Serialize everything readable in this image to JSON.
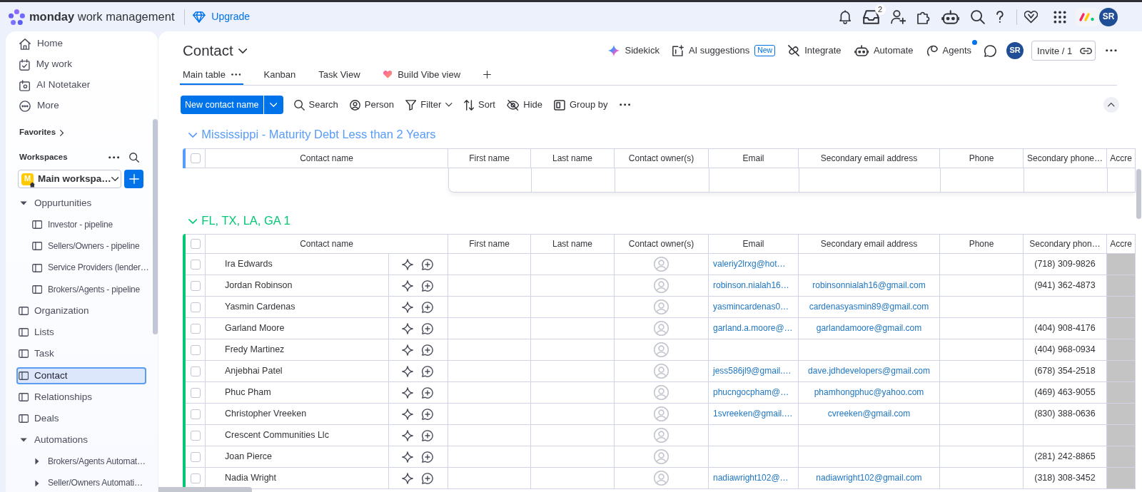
{
  "app_bar": {
    "brand": "**monday** work management",
    "upgrade": "Upgrade",
    "inbox_count": "2",
    "avatar": "SR"
  },
  "sidebar": {
    "nav": [
      {
        "label": "Home"
      },
      {
        "label": "My work"
      },
      {
        "label": "AI Notetaker"
      },
      {
        "label": "More"
      }
    ],
    "favorites": "Favorites",
    "workspaces": "Workspaces",
    "workspace": {
      "initial": "M",
      "name": "Main workspa…"
    },
    "tree": [
      {
        "label": "Oppurtunities",
        "kind": "folder",
        "expanded": true,
        "selected": false,
        "children": [
          {
            "label": "Investor - pipeline",
            "kind": "board",
            "selected": false
          },
          {
            "label": "Sellers/Owners - pipeline",
            "kind": "board",
            "selected": false
          },
          {
            "label": "Service Providers (lender…",
            "kind": "board",
            "selected": false
          },
          {
            "label": "Brokers/Agents - pipeline",
            "kind": "board",
            "selected": false
          }
        ]
      },
      {
        "label": "Organization",
        "kind": "board",
        "selected": false
      },
      {
        "label": "Lists",
        "kind": "board",
        "selected": false
      },
      {
        "label": "Task",
        "kind": "board",
        "selected": false
      },
      {
        "label": "Contact",
        "kind": "board",
        "selected": true
      },
      {
        "label": "Relationships",
        "kind": "board",
        "selected": false
      },
      {
        "label": "Deals",
        "kind": "board",
        "selected": false
      },
      {
        "label": "Automations",
        "kind": "folder",
        "expanded": true,
        "selected": false,
        "children": [
          {
            "label": "Brokers/Agents Automat…",
            "kind": "folder",
            "expanded": false,
            "selected": false
          },
          {
            "label": "Seller/Owners Automati…",
            "kind": "folder",
            "expanded": false,
            "selected": false
          }
        ]
      }
    ]
  },
  "board": {
    "title": "Contact",
    "actions": [
      {
        "label": "Sidekick",
        "notification": false
      },
      {
        "label": "AI suggestions",
        "badge": "New",
        "notification": false
      },
      {
        "label": "Integrate",
        "notification": false
      },
      {
        "label": "Automate",
        "notification": false
      },
      {
        "label": "Agents",
        "notification": true
      }
    ],
    "avatar": "SR",
    "invite": "Invite / 1",
    "views": [
      {
        "label": "Main table",
        "kind": "standard",
        "selected": true
      },
      {
        "label": "Kanban",
        "kind": "standard",
        "selected": false
      },
      {
        "label": "Task View",
        "kind": "standard",
        "selected": false
      },
      {
        "label": "Build Vibe view",
        "kind": "vibe",
        "selected": false
      }
    ],
    "toolbar": {
      "new_item": "New contact name",
      "tools": [
        {
          "label": "Search",
          "dropdown": false
        },
        {
          "label": "Person",
          "dropdown": false
        },
        {
          "label": "Filter",
          "dropdown": true
        },
        {
          "label": "Sort",
          "dropdown": false
        },
        {
          "label": "Hide",
          "dropdown": false
        },
        {
          "label": "Group by",
          "dropdown": false
        }
      ]
    }
  },
  "groups": [
    {
      "title": "Mississippi - Maturity Debt Less than 2 Years",
      "color": "#579bfc",
      "expanded": true,
      "select_all": false,
      "columns": [
        "Contact name",
        "First name",
        "Last name",
        "Contact owner(s)",
        "Email",
        "Secondary email address",
        "Phone",
        "Secondary phone…",
        "Accre"
      ]
    },
    {
      "title": "FL, TX, LA, GA 1",
      "color": "#00c875",
      "expanded": true,
      "select_all": false,
      "columns": [
        "Contact name",
        "First name",
        "Last name",
        "Contact owner(s)",
        "Email",
        "Secondary email address",
        "Phone",
        "Secondary phon…",
        "Accre"
      ],
      "rows": [
        {
          "name": "Ira Edwards",
          "checked": false,
          "email": "valeriy2lrxg@hot…",
          "secondary_phone": "(718) 309-9826"
        },
        {
          "name": "Jordan Robinson",
          "checked": false,
          "email": "robinson.nialah16…",
          "secondary_email": "robinsonnialah16@gmail.com",
          "secondary_phone": "(941) 362-4873"
        },
        {
          "name": "Yasmin Cardenas",
          "checked": false,
          "email": "yasmincardenas0…",
          "secondary_email": "cardenasyasmin89@gmail.com"
        },
        {
          "name": "Garland Moore",
          "checked": false,
          "email": "garland.a.moore@…",
          "secondary_email": "garlandamoore@gmail.com",
          "secondary_phone": "(404) 908-4176"
        },
        {
          "name": "Fredy Martinez",
          "checked": false,
          "secondary_phone": "(404) 968-0934"
        },
        {
          "name": "Anjebhai Patel",
          "checked": false,
          "email": "jess586jl9@gmail.…",
          "secondary_email": "dave.jdhdevelopers@gmail.com",
          "secondary_phone": "(678) 354-2518"
        },
        {
          "name": "Phuc Pham",
          "checked": false,
          "email": "phucngocpham@…",
          "secondary_email": "phamhongphuc@yahoo.com",
          "secondary_phone": "(469) 463-9055"
        },
        {
          "name": "Christopher Vreeken",
          "checked": false,
          "email": "1svreeken@gmail.…",
          "secondary_email": "cvreeken@gmail.com",
          "secondary_phone": "(830) 388-0636"
        },
        {
          "name": "Crescent Communities Llc",
          "checked": false
        },
        {
          "name": "Joan Pierce",
          "checked": false,
          "secondary_phone": "(281) 242-8865"
        },
        {
          "name": "Nadia Wright",
          "checked": false,
          "email": "nadiawright102@…",
          "secondary_email": "nadiawright102@gmail.com",
          "secondary_phone": "(318) 308-3452"
        }
      ]
    }
  ]
}
